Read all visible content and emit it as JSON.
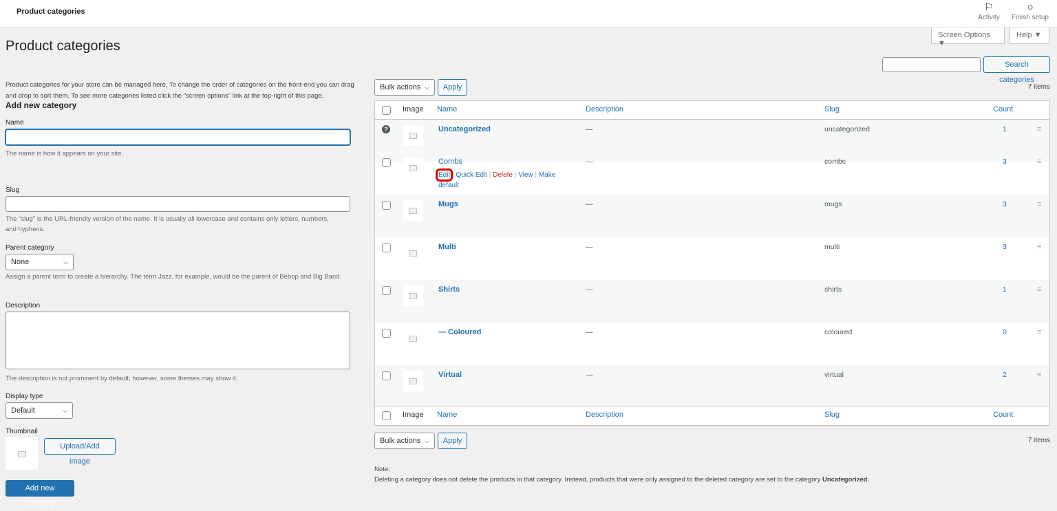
{
  "topbar": {
    "title": "Product categories",
    "activity_label": "Activity",
    "activity_icon": "flag-icon",
    "finish_label": "Finish setup",
    "finish_icon": "circle-icon"
  },
  "screen_options": {
    "screen_options_label": "Screen Options ▼",
    "help_label": "Help ▼"
  },
  "page": {
    "title": "Product categories",
    "intro": "Product categories for your store can be managed here. To change the order of categories on the front-end you can drag and drop to sort them. To see more categories listed click the \"screen options\" link at the top-right of this page."
  },
  "search": {
    "button_label": "Search categories",
    "value": ""
  },
  "form": {
    "heading": "Add new category",
    "name_label": "Name",
    "name_value": "",
    "name_help": "The name is how it appears on your site.",
    "slug_label": "Slug",
    "slug_value": "",
    "slug_help": "The \"slug\" is the URL-friendly version of the name. It is usually all lowercase and contains only letters, numbers, and hyphens.",
    "parent_label": "Parent category",
    "parent_value": "None",
    "parent_help": "Assign a parent term to create a hierarchy. The term Jazz, for example, would be the parent of Bebop and Big Band.",
    "description_label": "Description",
    "description_value": "",
    "description_help": "The description is not prominent by default; however, some themes may show it.",
    "display_type_label": "Display type",
    "display_type_value": "Default",
    "thumbnail_label": "Thumbnail",
    "upload_label": "Upload/Add image",
    "submit_label": "Add new category"
  },
  "table": {
    "bulk_label": "Bulk actions",
    "apply_label": "Apply",
    "items_count": "7 items",
    "columns": {
      "image": "Image",
      "name": "Name",
      "description": "Description",
      "slug": "Slug",
      "count": "Count"
    },
    "rows": [
      {
        "name": "Uncategorized",
        "description": "—",
        "slug": "uncategorized",
        "count": "1"
      },
      {
        "name": "Combs",
        "description": "—",
        "slug": "combs",
        "count": "3"
      },
      {
        "name": "Mugs",
        "description": "—",
        "slug": "mugs",
        "count": "3"
      },
      {
        "name": "Multi",
        "description": "—",
        "slug": "multi",
        "count": "3"
      },
      {
        "name": "Shirts",
        "description": "—",
        "slug": "shirts",
        "count": "1"
      },
      {
        "name": "— Coloured",
        "description": "—",
        "slug": "coloured",
        "count": "0"
      },
      {
        "name": "Virtual",
        "description": "—",
        "slug": "virtual",
        "count": "2"
      }
    ],
    "row_actions": {
      "edit": "Edit",
      "quick_edit": "Quick Edit",
      "delete": "Delete",
      "view": "View",
      "make_default": "Make default",
      "sep": " | "
    }
  },
  "note": {
    "label": "Note:",
    "text": "Deleting a category does not delete the products in that category. Instead, products that were only assigned to the deleted category are set to the category ",
    "emphasis": "Uncategorized",
    "end": "."
  },
  "colors": {
    "accent": "#2271b1",
    "delete": "#b32d2e",
    "highlight": "#e00000"
  }
}
